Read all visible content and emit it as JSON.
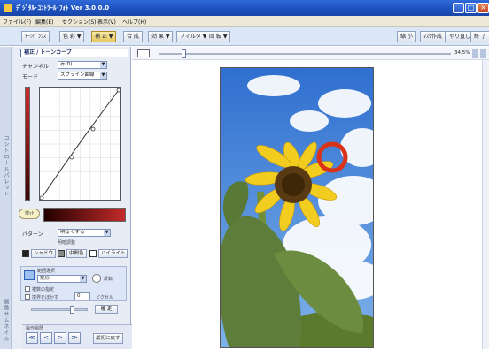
{
  "window": {
    "title": "ﾃﾞｼﾞﾀﾙ･ｺﾝﾄﾗｰﾙ･ﾌｫﾄ Ver 3.0.0.0",
    "minimize_label": "_",
    "maximize_label": "□",
    "close_label": "×"
  },
  "menu": [
    "ファイル(F)",
    "編集(E)",
    "セクション(S)",
    "表示(V)",
    "ヘルプ(H)"
  ],
  "toolbar": {
    "left_buttons": [
      "ﾄｰﾝﾊﾞﾗﾝｽ",
      "色 彩 ▼",
      "補 正 ▼",
      "合 成",
      "効 果 ▼",
      "フィルタ ▼",
      "回 転 ▼"
    ],
    "active_index": 2,
    "right_buttons": [
      "縮 小",
      "ﾏｽｸ作成",
      "やり直し",
      "終 了"
    ]
  },
  "side_panel": {
    "vertical_label": "コントロールパレット",
    "bottom_vertical_label": "画像サムネイル"
  },
  "curve_panel": {
    "title": "補正 / トーンカーブ",
    "channel_label": "チャンネル",
    "channel_value": "赤(R)",
    "mode_label": "モード",
    "mode_value": "スプライン曲線",
    "reset_label": "ﾘｾｯﾄ",
    "pattern_label": "パターン",
    "pattern_value": "明るくする",
    "sub_label": "明暗調整",
    "shadow_label": "シャドウ",
    "midtone_label": "中間色",
    "highlight_label": "ハイライト"
  },
  "selection_group": {
    "title": "範囲選択",
    "select_value": "矩形",
    "invert_label": "反転",
    "multi_label": "複数の指定",
    "blur_label": "境界をぼかす",
    "blur_value": "0",
    "pixel_label": "ピクセル",
    "confirm_label": "確 定"
  },
  "history": {
    "title": "操作履歴",
    "buttons": [
      "≪",
      "<",
      ">",
      "≫"
    ],
    "restore_label": "最初に戻す"
  },
  "canvas": {
    "zoom_text": "34.5%",
    "zoom_value": 0.08
  },
  "colors": {
    "titlebar": "#1c4fbd",
    "annotation_circle": "#d9331a",
    "sky": "#3f7fd6",
    "sunflower": "#f2cc1f"
  }
}
